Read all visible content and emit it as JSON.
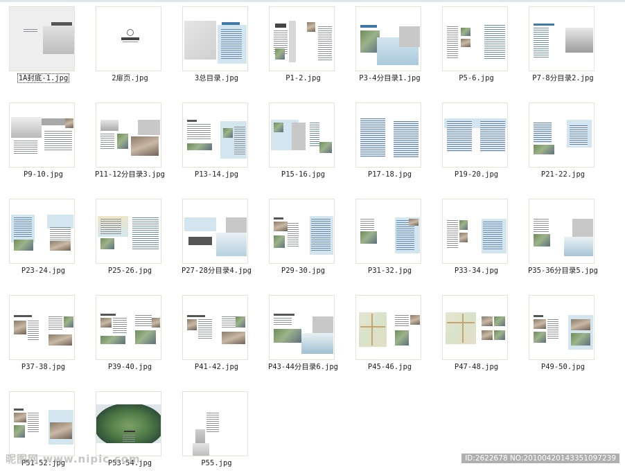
{
  "files": [
    {
      "label": "1A封底-1.jpg",
      "selected": true
    },
    {
      "label": "2扉页.jpg"
    },
    {
      "label": "3总目录.jpg"
    },
    {
      "label": "P1-2.jpg"
    },
    {
      "label": "P3-4分目录1.jpg"
    },
    {
      "label": "P5-6.jpg"
    },
    {
      "label": "P7-8分目录2.jpg"
    },
    {
      "label": "P9-10.jpg"
    },
    {
      "label": "P11-12分目录3.jpg"
    },
    {
      "label": "P13-14.jpg"
    },
    {
      "label": "P15-16.jpg"
    },
    {
      "label": "P17-18.jpg"
    },
    {
      "label": "P19-20.jpg"
    },
    {
      "label": "P21-22.jpg"
    },
    {
      "label": "P23-24.jpg"
    },
    {
      "label": "P25-26.jpg"
    },
    {
      "label": "P27-28分目录4.jpg"
    },
    {
      "label": "P29-30.jpg"
    },
    {
      "label": "P31-32.jpg"
    },
    {
      "label": "P33-34.jpg"
    },
    {
      "label": "P35-36分目录5.jpg"
    },
    {
      "label": "P37-38.jpg"
    },
    {
      "label": "P39-40.jpg"
    },
    {
      "label": "P41-42.jpg"
    },
    {
      "label": "P43-44分目录6.jpg"
    },
    {
      "label": "P45-46.jpg"
    },
    {
      "label": "P47-48.jpg"
    },
    {
      "label": "P49-50.jpg"
    },
    {
      "label": "P51-52.jpg"
    },
    {
      "label": "P53-54.jpg"
    },
    {
      "label": "P55.jpg"
    }
  ],
  "watermark": {
    "left": "昵图网 www.nipic.com",
    "right": "ID:2622678 NO:20100420143351097239"
  }
}
